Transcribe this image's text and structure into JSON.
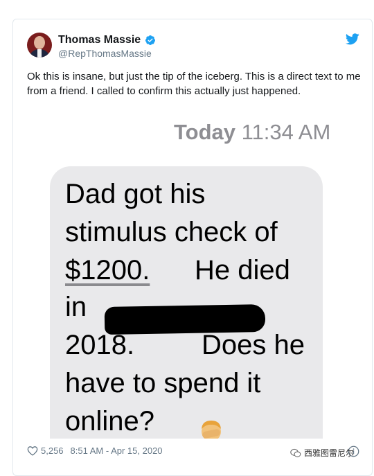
{
  "tweet": {
    "author_name": "Thomas Massie",
    "handle": "@RepThomasMassie",
    "text": "Ok this is insane, but just the tip of the iceberg. This is a direct text to me from a friend. I called to confirm this actually just happened.",
    "likes": "5,256",
    "timestamp": "8:51 AM - Apr 15, 2020"
  },
  "media": {
    "ts_day": "Today",
    "ts_time": "11:34 AM",
    "message_lines": [
      "Dad got his",
      "stimulus check of",
      "$1200.",
      "He died",
      "in",
      "2018.",
      "Does he",
      "have to spend it",
      "online?"
    ]
  },
  "watermark": "西雅图雷尼尔",
  "colors": {
    "verified": "#1da1f2",
    "twitter_blue": "#1da1f2",
    "bubble": "#e9e9eb",
    "muted": "#657786"
  },
  "icons": [
    "verified-badge-icon",
    "twitter-bird-icon",
    "heart-icon",
    "info-icon",
    "facepalm-emoji-icon",
    "wechat-icon"
  ]
}
